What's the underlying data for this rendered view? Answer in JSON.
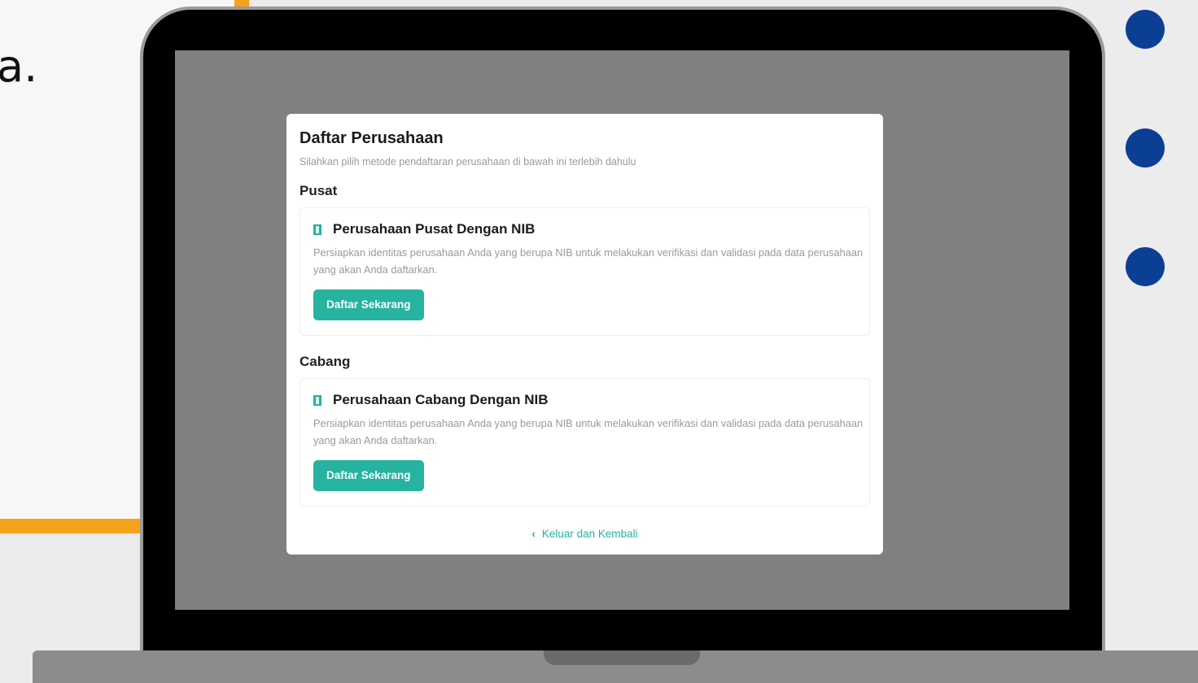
{
  "backdrop": {
    "side_text": "a.",
    "accent_color": "#f7a21b",
    "dot_color": "#0b3f94"
  },
  "modal": {
    "title": "Daftar Perusahaan",
    "subtitle": "Silahkan pilih metode pendaftaran perusahaan di bawah ini terlebih dahulu",
    "sections": [
      {
        "label": "Pusat",
        "option_title": "Perusahaan Pusat Dengan NIB",
        "option_desc": "Persiapkan identitas perusahaan Anda yang berupa NIB untuk melakukan verifikasi dan validasi pada data perusahaan yang akan Anda daftarkan.",
        "button_label": "Daftar Sekarang",
        "icon": "bookmark-icon"
      },
      {
        "label": "Cabang",
        "option_title": "Perusahaan Cabang Dengan NIB",
        "option_desc": "Persiapkan identitas perusahaan Anda yang berupa NIB untuk melakukan verifikasi dan validasi pada data perusahaan yang akan Anda daftarkan.",
        "button_label": "Daftar Sekarang",
        "icon": "bookmark-icon"
      }
    ],
    "back_link_label": "Keluar dan Kembali",
    "back_icon": "chevron-left-icon",
    "accent_color": "#26b3a0"
  }
}
